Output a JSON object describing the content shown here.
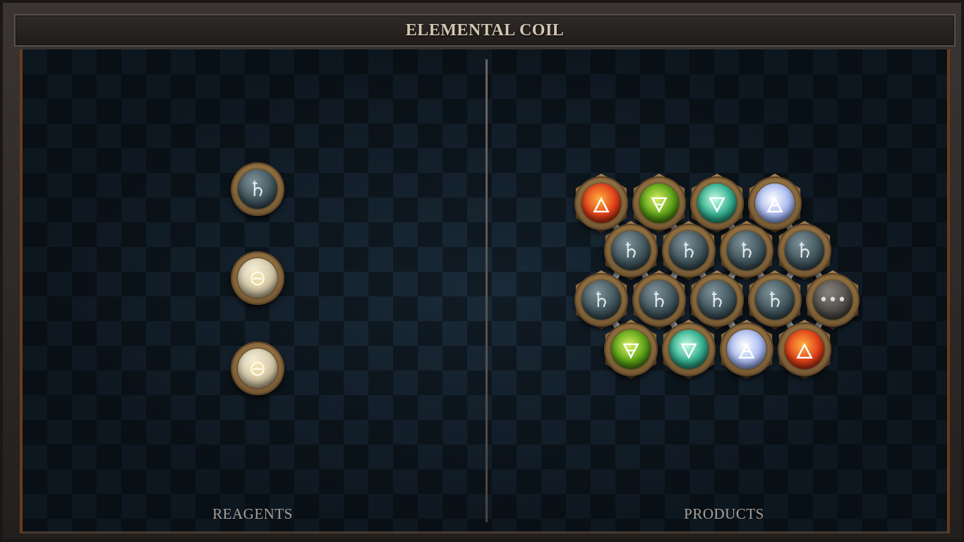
{
  "title": "ELEMENTAL COIL",
  "reagents_label": "REAGENTS",
  "products_label": "PRODUCTS",
  "symbols": {
    "lead": "♄",
    "salt": "⊖",
    "fire": "🜂",
    "earth": "🜃",
    "water": "🜄",
    "air": "🜁",
    "quintessence": "•••"
  },
  "reagents": [
    {
      "element": "lead",
      "symbol": "♄"
    },
    {
      "element": "salt",
      "symbol": "⊖"
    },
    {
      "element": "salt",
      "symbol": "⊖"
    }
  ],
  "product_rows": [
    [
      "fire",
      "earth",
      "water",
      "air"
    ],
    [
      "lead",
      "lead",
      "lead",
      "lead"
    ],
    [
      "lead",
      "lead",
      "lead",
      "lead",
      "quintessence"
    ],
    [
      "earth",
      "water",
      "air",
      "fire"
    ]
  ]
}
